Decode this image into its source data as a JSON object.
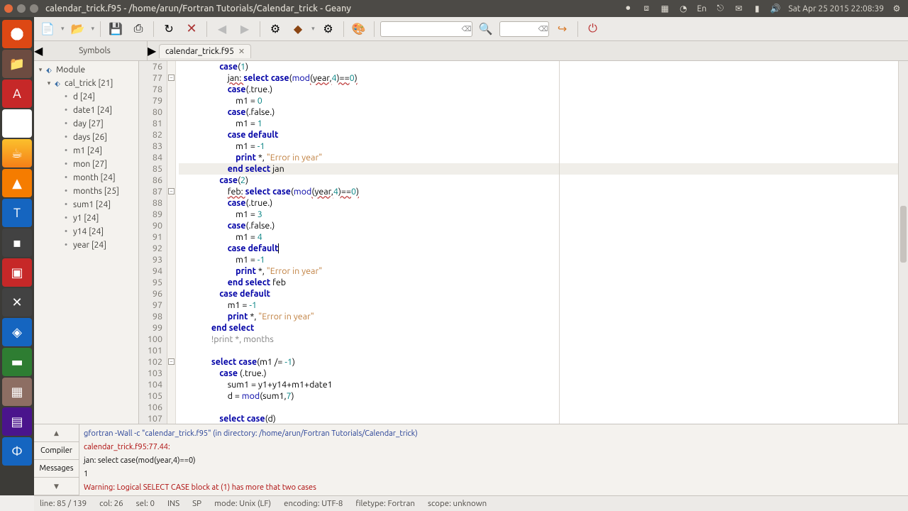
{
  "titlebar": "calendar_trick.f95 - /home/arun/Fortran Tutorials/Calendar_trick - Geany",
  "clock": "Sat Apr 25 2015 22:08:39",
  "tray_lang": "En",
  "tabs": {
    "symbols": "Symbols",
    "file": "calendar_trick.f95"
  },
  "tree": {
    "module": "Module",
    "cal_trick": "cal_trick [21]",
    "items": [
      "d [24]",
      "date1 [24]",
      "day [27]",
      "days [26]",
      "m1 [24]",
      "mon [27]",
      "month [24]",
      "months [25]",
      "sum1 [24]",
      "y1 [24]",
      "y14 [24]",
      "year [24]"
    ]
  },
  "lines_start": 76,
  "code": [
    {
      "n": 76,
      "i": 20,
      "t": [
        [
          "kw",
          "case"
        ],
        [
          "",
          "("
        ],
        [
          "num",
          "1"
        ],
        [
          "",
          ")"
        ]
      ]
    },
    {
      "n": 77,
      "i": 24,
      "t": [
        [
          "underln",
          "jan: "
        ],
        [
          "kw",
          "select case"
        ],
        [
          "",
          "("
        ],
        [
          "func",
          "mod"
        ],
        [
          "underln",
          "(year,"
        ],
        [
          "num",
          "4"
        ],
        [
          "underln",
          ")=="
        ],
        [
          "num",
          "0"
        ],
        [
          "underln",
          ")"
        ]
      ]
    },
    {
      "n": 78,
      "i": 24,
      "t": [
        [
          "kw",
          "case"
        ],
        [
          "",
          "(.true.)"
        ]
      ]
    },
    {
      "n": 79,
      "i": 28,
      "t": [
        [
          "",
          "m1 = "
        ],
        [
          "num",
          "0"
        ]
      ]
    },
    {
      "n": 80,
      "i": 24,
      "t": [
        [
          "kw",
          "case"
        ],
        [
          "",
          "(.false.)"
        ]
      ]
    },
    {
      "n": 81,
      "i": 28,
      "t": [
        [
          "",
          "m1 = "
        ],
        [
          "num",
          "1"
        ]
      ]
    },
    {
      "n": 82,
      "i": 24,
      "t": [
        [
          "kw",
          "case default"
        ]
      ]
    },
    {
      "n": 83,
      "i": 28,
      "t": [
        [
          "",
          "m1 = "
        ],
        [
          "num",
          "-1"
        ]
      ]
    },
    {
      "n": 84,
      "i": 28,
      "t": [
        [
          "kw",
          "print"
        ],
        [
          "",
          " *, "
        ],
        [
          "str",
          "\"Error in year\""
        ]
      ]
    },
    {
      "n": 85,
      "i": 24,
      "hl": true,
      "t": [
        [
          "kw",
          "end select"
        ],
        [
          "",
          " jan"
        ]
      ]
    },
    {
      "n": 86,
      "i": 20,
      "t": [
        [
          "kw",
          "case"
        ],
        [
          "",
          "("
        ],
        [
          "num",
          "2"
        ],
        [
          "",
          ")"
        ]
      ]
    },
    {
      "n": 87,
      "i": 24,
      "t": [
        [
          "underln",
          "feb: "
        ],
        [
          "kw",
          "select case"
        ],
        [
          "",
          "("
        ],
        [
          "func",
          "mod"
        ],
        [
          "underln",
          "(year,"
        ],
        [
          "num",
          "4"
        ],
        [
          "underln",
          ")=="
        ],
        [
          "num",
          "0"
        ],
        [
          "underln",
          ")"
        ]
      ]
    },
    {
      "n": 88,
      "i": 24,
      "t": [
        [
          "kw",
          "case"
        ],
        [
          "",
          "(.true.)"
        ]
      ]
    },
    {
      "n": 89,
      "i": 28,
      "t": [
        [
          "",
          "m1 = "
        ],
        [
          "num",
          "3"
        ]
      ]
    },
    {
      "n": 90,
      "i": 24,
      "t": [
        [
          "kw",
          "case"
        ],
        [
          "",
          "(.false.)"
        ]
      ]
    },
    {
      "n": 91,
      "i": 28,
      "t": [
        [
          "",
          "m1 = "
        ],
        [
          "num",
          "4"
        ]
      ]
    },
    {
      "n": 92,
      "i": 24,
      "t": [
        [
          "kw",
          "case default"
        ]
      ],
      "caret_after": true
    },
    {
      "n": 93,
      "i": 28,
      "t": [
        [
          "",
          "m1 = "
        ],
        [
          "num",
          "-1"
        ]
      ]
    },
    {
      "n": 94,
      "i": 28,
      "t": [
        [
          "kw",
          "print"
        ],
        [
          "",
          " *, "
        ],
        [
          "str",
          "\"Error in year\""
        ]
      ]
    },
    {
      "n": 95,
      "i": 24,
      "t": [
        [
          "kw",
          "end select"
        ],
        [
          "",
          " feb"
        ]
      ]
    },
    {
      "n": 96,
      "i": 20,
      "t": [
        [
          "kw",
          "case default"
        ]
      ]
    },
    {
      "n": 97,
      "i": 24,
      "t": [
        [
          "",
          "m1 = "
        ],
        [
          "num",
          "-1"
        ]
      ]
    },
    {
      "n": 98,
      "i": 24,
      "t": [
        [
          "kw",
          "print"
        ],
        [
          "",
          " *, "
        ],
        [
          "str",
          "\"Error in year\""
        ]
      ]
    },
    {
      "n": 99,
      "i": 16,
      "t": [
        [
          "kw",
          "end select"
        ]
      ]
    },
    {
      "n": 100,
      "i": 16,
      "t": [
        [
          "comment",
          "!print *, months"
        ]
      ]
    },
    {
      "n": 101,
      "i": 0,
      "t": [
        [
          "",
          ""
        ]
      ]
    },
    {
      "n": 102,
      "i": 16,
      "t": [
        [
          "kw",
          "select case"
        ],
        [
          "",
          "(m1 /= "
        ],
        [
          "num",
          "-1"
        ],
        [
          "",
          ")"
        ]
      ]
    },
    {
      "n": 103,
      "i": 20,
      "t": [
        [
          "kw",
          "case"
        ],
        [
          "",
          " (.true.)"
        ]
      ]
    },
    {
      "n": 104,
      "i": 24,
      "t": [
        [
          "",
          "sum1 = y1+y14+m1+date1"
        ]
      ]
    },
    {
      "n": 105,
      "i": 24,
      "t": [
        [
          "",
          "d = "
        ],
        [
          "func",
          "mod"
        ],
        [
          "",
          "(sum1,"
        ],
        [
          "num",
          "7"
        ],
        [
          "",
          ")"
        ]
      ]
    },
    {
      "n": 106,
      "i": 0,
      "t": [
        [
          "",
          ""
        ]
      ]
    },
    {
      "n": 107,
      "i": 20,
      "t": [
        [
          "kw",
          "select case"
        ],
        [
          "",
          "(d)"
        ]
      ]
    }
  ],
  "messages": {
    "tabs": {
      "compiler": "Compiler",
      "messages": "Messages"
    },
    "lines": [
      {
        "cls": "msg-blue",
        "text": "gfortran -Wall -c \"calendar_trick.f95\" (in directory: /home/arun/Fortran Tutorials/Calendar_trick)"
      },
      {
        "cls": "msg-red",
        "text": "calendar_trick.f95:77.44:"
      },
      {
        "cls": "",
        "text": "            jan: select case(mod(year,4)==0)"
      },
      {
        "cls": "",
        "text": "                                            1"
      },
      {
        "cls": "msg-red",
        "text": "Warning: Logical SELECT CASE block at (1) has more that two cases"
      }
    ]
  },
  "status": {
    "line": "line: 85 / 139",
    "col": "col: 26",
    "sel": "sel: 0",
    "ins": "INS",
    "sp": "SP",
    "mode": "mode: Unix (LF)",
    "enc": "encoding: UTF-8",
    "filetype": "filetype: Fortran",
    "scope": "scope: unknown"
  }
}
